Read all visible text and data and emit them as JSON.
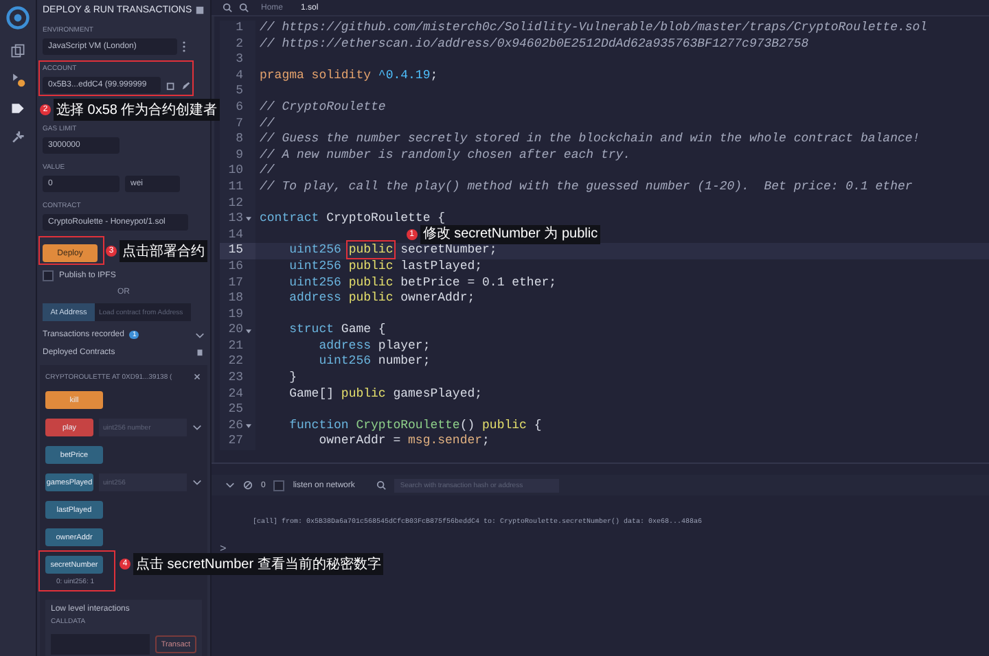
{
  "panel": {
    "title": "DEPLOY & RUN TRANSACTIONS",
    "environment": {
      "label": "ENVIRONMENT",
      "value": "JavaScript VM (London)"
    },
    "account": {
      "label": "ACCOUNT",
      "value": "0x5B3...eddC4 (99.999999",
      "callout": {
        "number": "2",
        "text": "选择 0x58 作为合约创建者"
      }
    },
    "gas_limit": {
      "label": "GAS LIMIT",
      "value": "3000000"
    },
    "value": {
      "label": "VALUE",
      "value": "0",
      "unit": "wei"
    },
    "contract": {
      "label": "CONTRACT",
      "value": "CryptoRoulette - Honeypot/1.sol"
    },
    "deploy": {
      "label": "Deploy",
      "callout": {
        "number": "3",
        "text": "点击部署合约"
      }
    },
    "publish": {
      "label": "Publish to IPFS",
      "checked": false
    },
    "or": "OR",
    "at_address": {
      "button": "At Address",
      "placeholder": "Load contract from Address"
    },
    "transactions_recorded": {
      "label": "Transactions recorded",
      "count": "1"
    },
    "deployed_contracts": "Deployed Contracts",
    "instance": "CRYPTOROULETTE AT 0XD91...39138 (",
    "functions": [
      {
        "name": "kill",
        "kind": "transact"
      },
      {
        "name": "play",
        "kind": "payable",
        "placeholder": "uint256 number"
      },
      {
        "name": "betPrice",
        "kind": "call"
      },
      {
        "name": "gamesPlayed",
        "kind": "call",
        "placeholder": "uint256"
      },
      {
        "name": "lastPlayed",
        "kind": "call"
      },
      {
        "name": "ownerAddr",
        "kind": "call"
      },
      {
        "name": "secretNumber",
        "kind": "call",
        "result": "0: uint256: 1",
        "callout": {
          "number": "4",
          "text": "点击 secretNumber 查看当前的秘密数字"
        }
      }
    ],
    "low_level": {
      "title": "Low level interactions",
      "calldata": "CALLDATA",
      "button": "Transact"
    }
  },
  "editor": {
    "tabs": [
      {
        "label": "Home",
        "selected": false
      },
      {
        "label": "1.sol",
        "selected": true
      }
    ],
    "lines": [
      {
        "number": "1",
        "foldable": false,
        "current": false,
        "segments": [
          {
            "kind": "comment",
            "text": "// https://github.com/misterch0c/Solidlity-Vulnerable/blob/master/traps/CryptoRoulette.sol"
          }
        ]
      },
      {
        "number": "2",
        "foldable": false,
        "current": false,
        "segments": [
          {
            "kind": "comment",
            "text": "// https://etherscan.io/address/0x94602b0E2512DdAd62a935763BF1277c973B2758"
          }
        ]
      },
      {
        "number": "3",
        "foldable": false,
        "current": false
      },
      {
        "number": "4",
        "foldable": false,
        "current": false,
        "segments": [
          {
            "kind": "pragma",
            "text": "pragma solidity "
          },
          {
            "kind": "version",
            "text": "^0.4.19"
          },
          {
            "kind": "plain",
            "text": ";"
          }
        ]
      },
      {
        "number": "5",
        "foldable": false,
        "current": false
      },
      {
        "number": "6",
        "foldable": false,
        "current": false,
        "segments": [
          {
            "kind": "comment",
            "text": "// CryptoRoulette"
          }
        ]
      },
      {
        "number": "7",
        "foldable": false,
        "current": false,
        "segments": [
          {
            "kind": "comment",
            "text": "//"
          }
        ]
      },
      {
        "number": "8",
        "foldable": false,
        "current": false,
        "segments": [
          {
            "kind": "comment",
            "text": "// Guess the number secretly stored in the blockchain and win the whole contract balance!"
          }
        ]
      },
      {
        "number": "9",
        "foldable": false,
        "current": false,
        "segments": [
          {
            "kind": "comment",
            "text": "// A new number is randomly chosen after each try."
          }
        ]
      },
      {
        "number": "10",
        "foldable": false,
        "current": false,
        "segments": [
          {
            "kind": "comment",
            "text": "//"
          }
        ]
      },
      {
        "number": "11",
        "foldable": false,
        "current": false,
        "segments": [
          {
            "kind": "comment",
            "text": "// To play, call the play() method with the guessed number (1-20).  Bet price: 0.1 ether"
          }
        ]
      },
      {
        "number": "12",
        "foldable": false,
        "current": false
      },
      {
        "number": "13",
        "foldable": true,
        "current": false,
        "segments": [
          {
            "kind": "keyword",
            "text": "contract"
          },
          {
            "kind": "plain",
            "text": " CryptoRoulette {"
          }
        ]
      },
      {
        "number": "14",
        "foldable": false,
        "current": false
      },
      {
        "number": "15",
        "foldable": false,
        "current": true,
        "segments": [
          {
            "kind": "keyword",
            "text": "    uint256 "
          },
          {
            "kind": "visibility",
            "text": "public",
            "callout": {
              "number": "1",
              "text": "修改 secretNumber 为 public"
            }
          },
          {
            "kind": "plain",
            "text": " secretNumber;"
          }
        ]
      },
      {
        "number": "16",
        "foldable": false,
        "current": false,
        "segments": [
          {
            "kind": "keyword",
            "text": "    uint256 "
          },
          {
            "kind": "visibility",
            "text": "public"
          },
          {
            "kind": "plain",
            "text": " lastPlayed;"
          }
        ]
      },
      {
        "number": "17",
        "foldable": false,
        "current": false,
        "segments": [
          {
            "kind": "keyword",
            "text": "    uint256 "
          },
          {
            "kind": "visibility",
            "text": "public"
          },
          {
            "kind": "plain",
            "text": " betPrice = 0.1 ether;"
          }
        ]
      },
      {
        "number": "18",
        "foldable": false,
        "current": false,
        "segments": [
          {
            "kind": "keyword",
            "text": "    address "
          },
          {
            "kind": "visibility",
            "text": "public"
          },
          {
            "kind": "plain",
            "text": " ownerAddr;"
          }
        ]
      },
      {
        "number": "19",
        "foldable": false,
        "current": false
      },
      {
        "number": "20",
        "foldable": true,
        "current": false,
        "segments": [
          {
            "kind": "keyword",
            "text": "    struct"
          },
          {
            "kind": "plain",
            "text": " Game {"
          }
        ]
      },
      {
        "number": "21",
        "foldable": false,
        "current": false,
        "segments": [
          {
            "kind": "keyword",
            "text": "        address"
          },
          {
            "kind": "plain",
            "text": " player;"
          }
        ]
      },
      {
        "number": "22",
        "foldable": false,
        "current": false,
        "segments": [
          {
            "kind": "keyword",
            "text": "        uint256"
          },
          {
            "kind": "plain",
            "text": " number;"
          }
        ]
      },
      {
        "number": "23",
        "foldable": false,
        "current": false,
        "segments": [
          {
            "kind": "plain",
            "text": "    }"
          }
        ]
      },
      {
        "number": "24",
        "foldable": false,
        "current": false,
        "segments": [
          {
            "kind": "plain",
            "text": "    Game[] "
          },
          {
            "kind": "visibility",
            "text": "public"
          },
          {
            "kind": "plain",
            "text": " gamesPlayed;"
          }
        ]
      },
      {
        "number": "25",
        "foldable": false,
        "current": false
      },
      {
        "number": "26",
        "foldable": true,
        "current": false,
        "segments": [
          {
            "kind": "keyword",
            "text": "    function"
          },
          {
            "kind": "name",
            "text": " CryptoRoulette"
          },
          {
            "kind": "plain",
            "text": "() "
          },
          {
            "kind": "visibility",
            "text": "public"
          },
          {
            "kind": "plain",
            "text": " {"
          }
        ]
      },
      {
        "number": "27",
        "foldable": false,
        "current": false,
        "segments": [
          {
            "kind": "plain",
            "text": "        ownerAddr = "
          },
          {
            "kind": "builtin",
            "text": "msg.sender"
          },
          {
            "kind": "plain",
            "text": ";"
          }
        ]
      }
    ]
  },
  "terminal": {
    "pending": "0",
    "listen": {
      "label": "listen on network",
      "checked": false
    },
    "search": {
      "placeholder": "Search with transaction hash or address"
    },
    "log": "[call] from: 0x5B38Da6a701c568545dCfcB03FcB875f56beddC4 to: CryptoRoulette.secretNumber() data: 0xe68...488a6",
    "prompt": ">"
  }
}
